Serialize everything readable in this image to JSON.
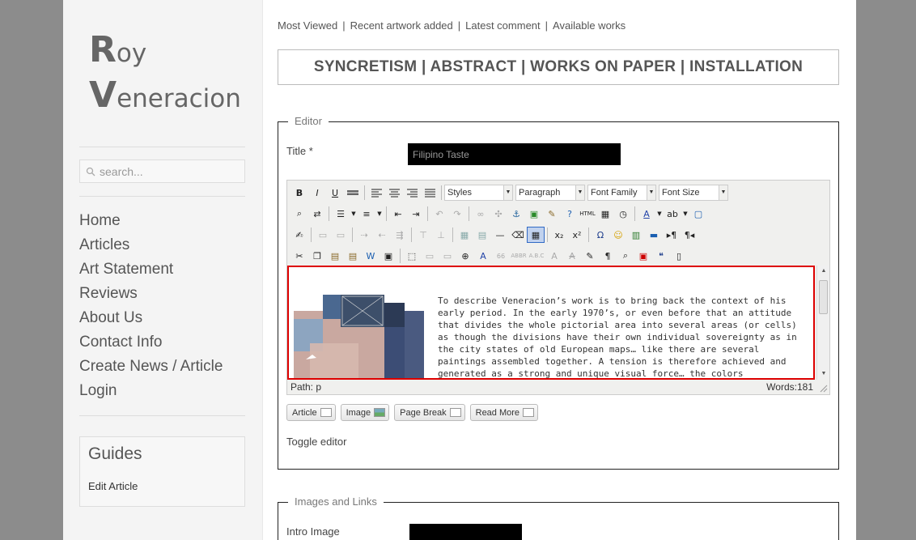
{
  "logo": {
    "line1_big": "R",
    "line1_small": "oy",
    "line2_big": "V",
    "line2_small": "eneracion"
  },
  "search": {
    "placeholder": "search..."
  },
  "nav": [
    "Home",
    "Articles",
    "Art Statement",
    "Reviews",
    "About Us",
    "Contact Info",
    "Create News / Article",
    "Login"
  ],
  "guides": {
    "title": "Guides",
    "link": "Edit Article"
  },
  "toplinks": [
    "Most Viewed",
    "Recent artwork added",
    "Latest comment",
    "Available works"
  ],
  "banner": "SYNCRETISM | ABSTRACT | WORKS ON PAPER | INSTALLATION",
  "editor_fieldset": {
    "legend": "Editor",
    "title_label": "Title *",
    "title_value": "Filipino Taste",
    "dropdowns": {
      "styles": "Styles",
      "paragraph": "Paragraph",
      "font_family": "Font Family",
      "font_size": "Font Size"
    },
    "body_text": "To describe Veneracion’s work is to bring back the context of his early period. In the early 1970’s, or even before that an attitude that divides the whole pictorial area into several areas (or cells) as though the divisions have their own individual sovereignty as in the city states of old European maps… like there are several paintings assembled together. A tension is therefore achieved and generated as a strong and unique visual force… the colors reverberate, resound. They do not deal with transparencies or lateral movement; they provide a frenzied structure built",
    "path_label": "Path:",
    "path_value": "p",
    "words_label": "Words:",
    "words_value": "181",
    "buttons": [
      "Article",
      "Image",
      "Page Break",
      "Read More"
    ],
    "toggle": "Toggle editor"
  },
  "images_fieldset": {
    "legend": "Images and Links",
    "intro_label": "Intro Image"
  },
  "colors": {
    "accent_red": "#dd0000",
    "active_blue": "#316ac5"
  }
}
